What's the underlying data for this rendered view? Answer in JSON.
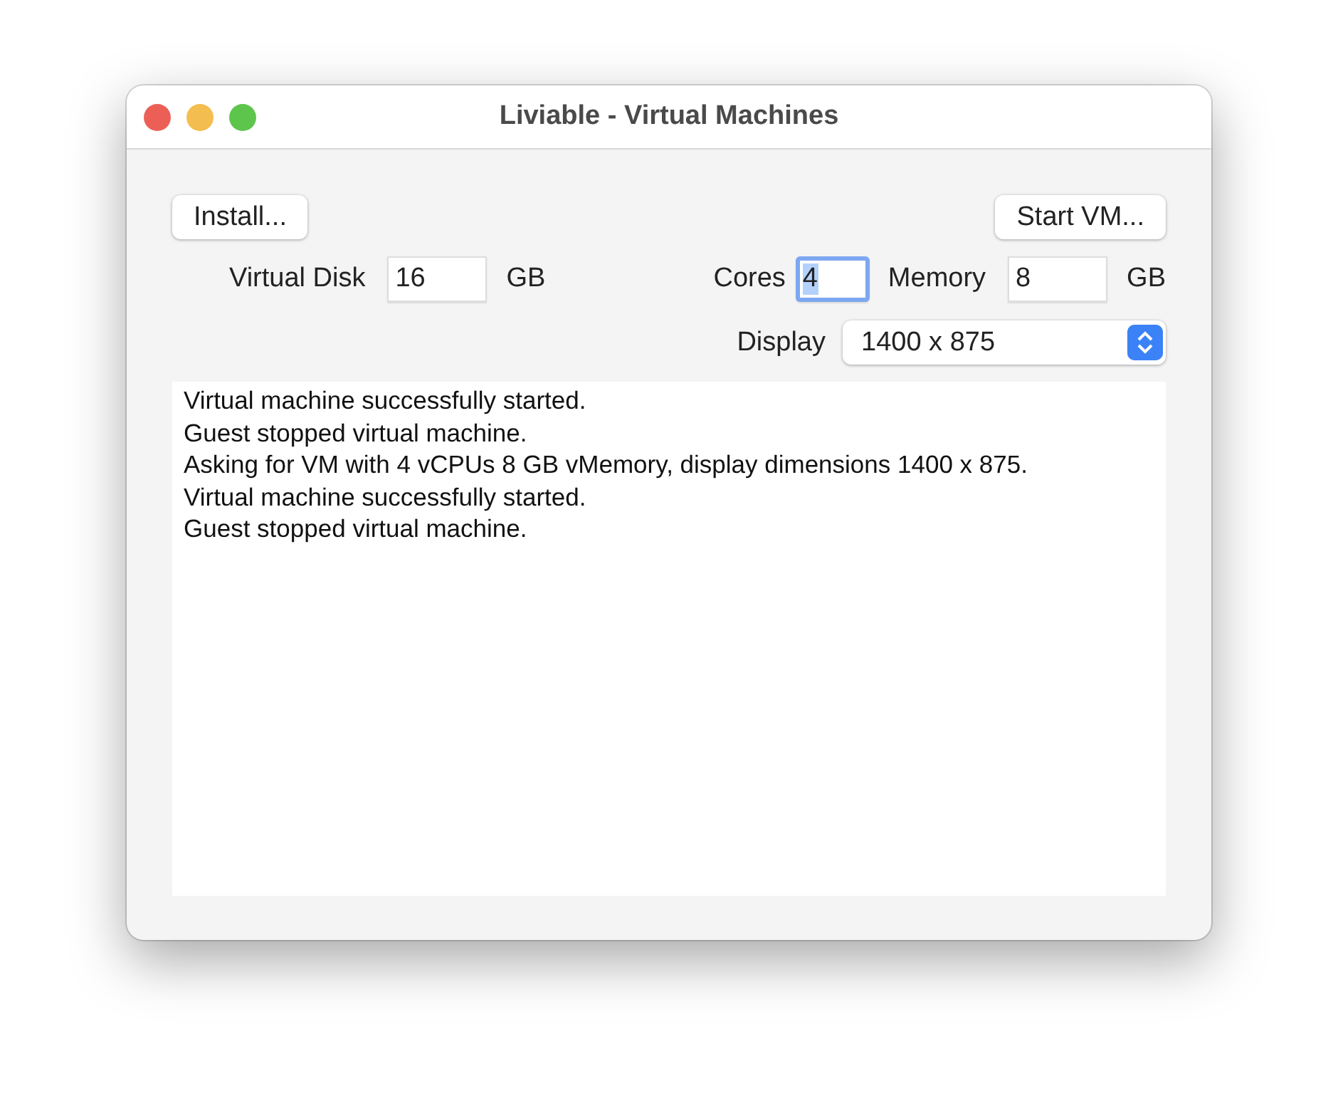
{
  "window": {
    "title": "Liviable - Virtual Machines"
  },
  "buttons": [
    {
      "label": "Install..."
    },
    {
      "label": "Start VM..."
    }
  ],
  "fields": [
    {
      "label": "Virtual Disk",
      "value": "16",
      "unit": "GB",
      "focused": false
    },
    {
      "label": "Cores",
      "value": "4",
      "focused": true
    },
    {
      "label": "Memory",
      "value": "8",
      "unit": "GB",
      "focused": false
    }
  ],
  "display": {
    "label": "Display",
    "value": "1400 x 875"
  },
  "log": [
    "Virtual machine successfully started.",
    "Guest stopped virtual machine.",
    "Asking for VM with 4 vCPUs 8 GB vMemory, display dimensions 1400 x 875.",
    "Virtual machine successfully started.",
    "Guest stopped virtual machine."
  ]
}
